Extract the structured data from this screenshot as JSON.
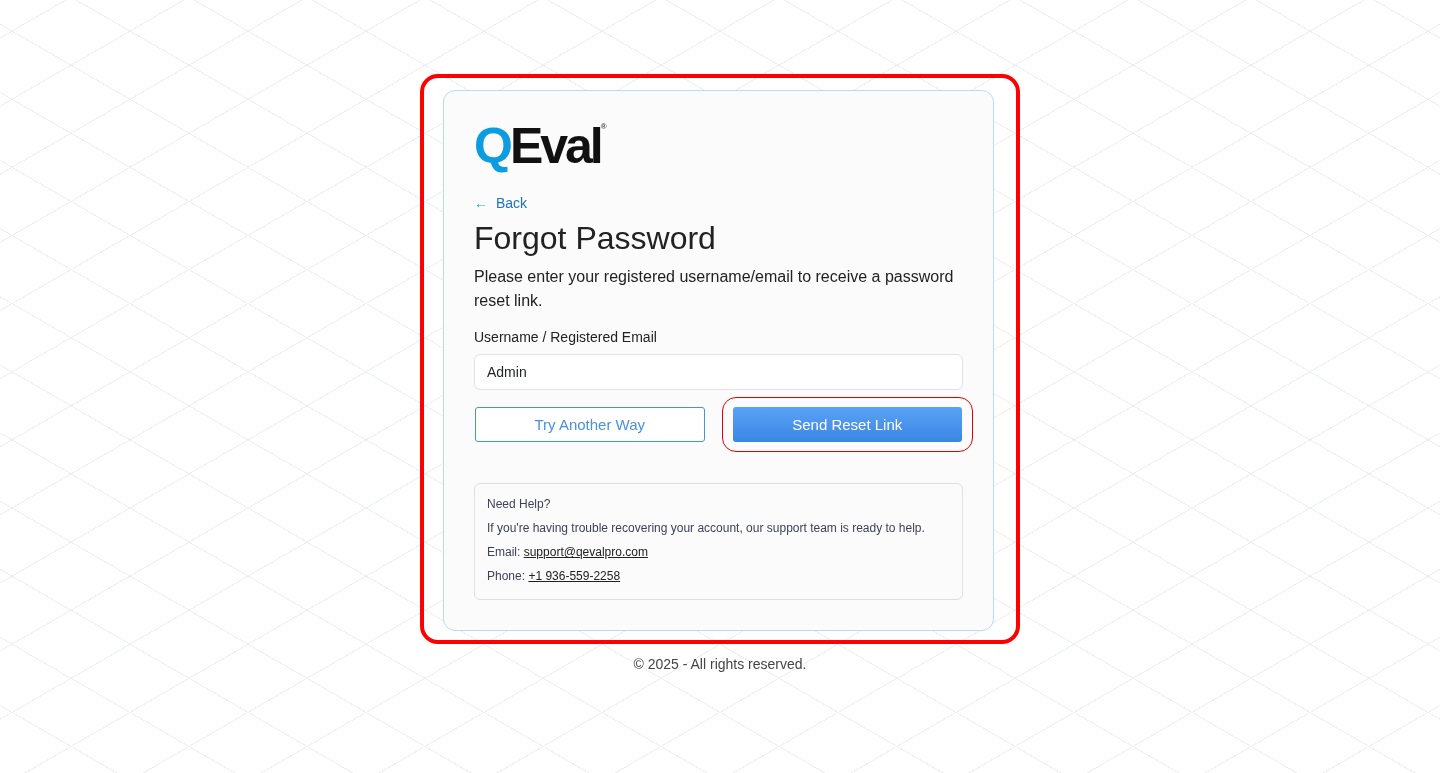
{
  "logo": {
    "mark": "Q",
    "word": "Eval",
    "registered": "®"
  },
  "back_link": {
    "arrow": "←",
    "label": "Back"
  },
  "title": "Forgot Password",
  "description": "Please enter your registered username/email to receive a password reset link.",
  "field": {
    "label": "Username / Registered Email",
    "value": "Admin"
  },
  "buttons": [
    {
      "label": "Try Another Way",
      "kind": "outline",
      "highlighted": false
    },
    {
      "label": "Send Reset Link",
      "kind": "primary",
      "highlighted": true
    }
  ],
  "help": {
    "title": "Need Help?",
    "text": "If you're having trouble recovering your account, our support team is ready to help.",
    "email_label": "Email:",
    "email": "support@qevalpro.com",
    "phone_label": "Phone:",
    "phone": "+1 936-559-2258"
  },
  "card_highlighted": true,
  "footer": "© 2025 - All rights reserved."
}
